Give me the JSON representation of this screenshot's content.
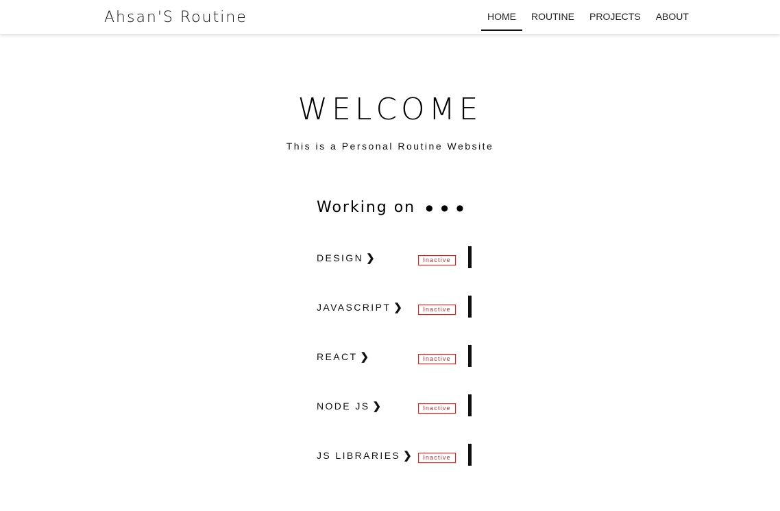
{
  "nav": {
    "brand": "Ahsan'S Routine",
    "links": [
      {
        "label": "HOME",
        "active": true
      },
      {
        "label": "ROUTINE",
        "active": false
      },
      {
        "label": "PROJECTS",
        "active": false
      },
      {
        "label": "ABOUT",
        "active": false
      }
    ]
  },
  "hero": {
    "title": "WELCOME",
    "subtitle": "This is a Personal Routine Website"
  },
  "working": {
    "heading": "Working on",
    "dots": "● ● ●",
    "items": [
      {
        "label": "DESIGN",
        "chevron": "❯",
        "status": "Inactive"
      },
      {
        "label": "JAVASCRIPT",
        "chevron": "❯",
        "status": "Inactive"
      },
      {
        "label": "REACT",
        "chevron": "❯",
        "status": "Inactive"
      },
      {
        "label": "NODE JS",
        "chevron": "❯",
        "status": "Inactive"
      },
      {
        "label": "JS LIBRARIES",
        "chevron": "❯",
        "status": "Inactive"
      }
    ]
  },
  "colors": {
    "inactive": "#c62828",
    "text": "#111111",
    "background": "#ffffff"
  }
}
